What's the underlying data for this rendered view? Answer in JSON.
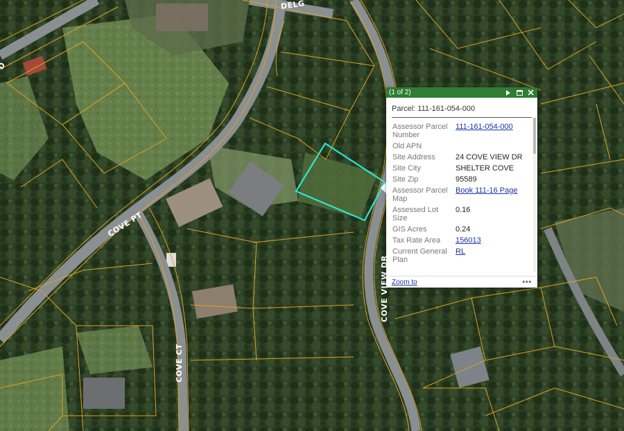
{
  "map": {
    "roads": {
      "cove_pt": "COVE PT",
      "cove_ct": "COVE CT",
      "cove_view_dr": "COVE VIEW DR",
      "delgada": "DELG"
    },
    "colors": {
      "parcel_line": "#e0a020",
      "selected_parcel": "#2ee6d2",
      "vegetation": "#2a3d22",
      "road": "#8a8f92"
    }
  },
  "popup": {
    "count": "(1 of 2)",
    "title": "Parcel: 111-161-054-000",
    "attributes": [
      {
        "key": "Assessor Parcel Number",
        "value": "111-161-054-000",
        "link": true
      },
      {
        "key": "Old APN",
        "value": "",
        "link": false
      },
      {
        "key": "Site Address",
        "value": "24 COVE VIEW DR",
        "link": false
      },
      {
        "key": "Site City",
        "value": "SHELTER COVE",
        "link": false
      },
      {
        "key": "Site Zip",
        "value": "95589",
        "link": false
      },
      {
        "key": "Assessor Parcel Map",
        "value": "Book 111-16 Page",
        "link": true
      },
      {
        "key": "Assessed Lot Size",
        "value": "0.16",
        "link": false
      },
      {
        "key": "GIS Acres",
        "value": "0.24",
        "link": false
      },
      {
        "key": "Tax Rate Area",
        "value": "156013",
        "link": true
      },
      {
        "key": "Current General Plan",
        "value": "RL",
        "link": true
      }
    ],
    "zoom_label": "Zoom to",
    "more_label": "•••",
    "icons": [
      "next-icon",
      "maximize-icon",
      "close-icon"
    ],
    "header_color": "#2e7d32"
  }
}
